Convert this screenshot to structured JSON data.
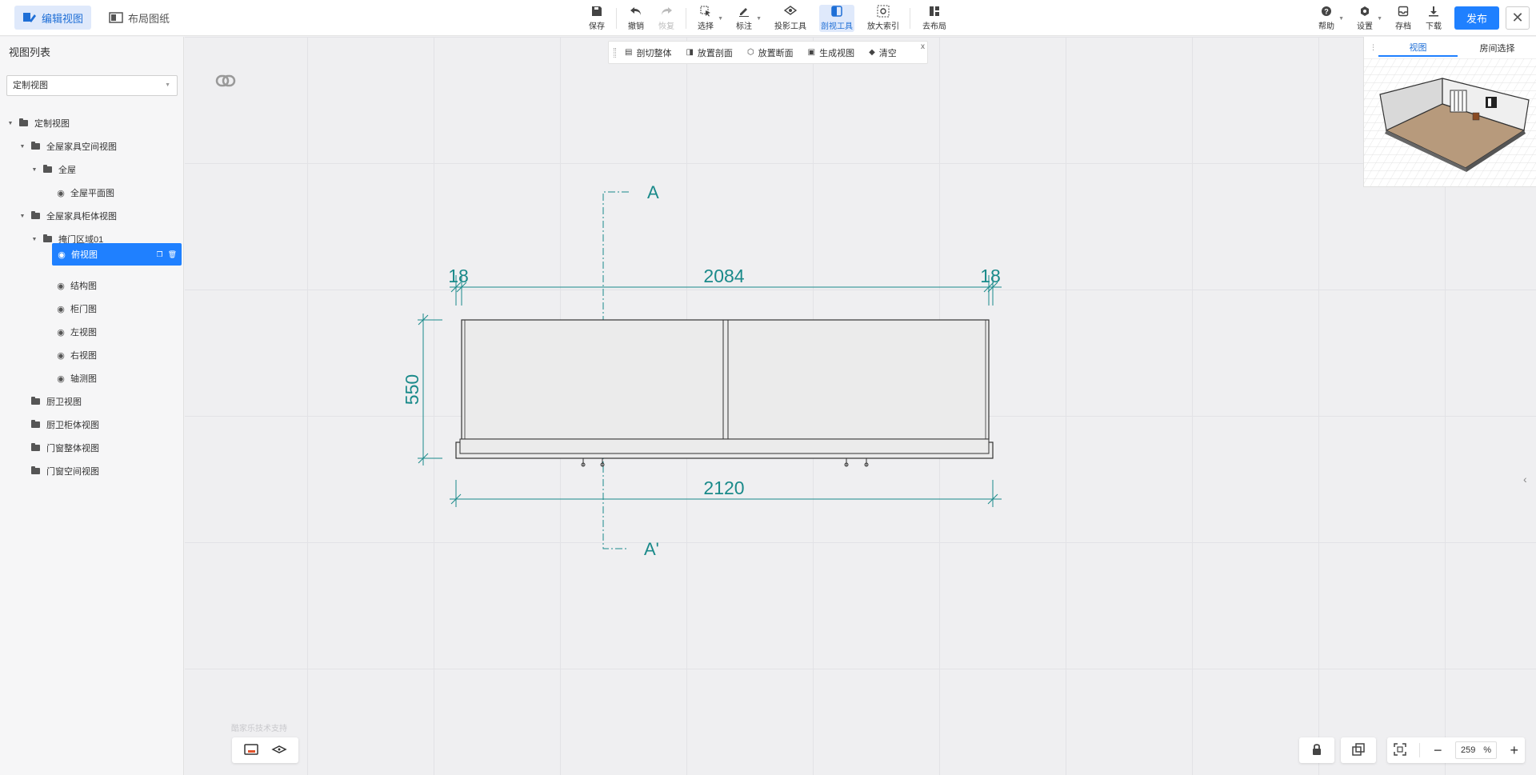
{
  "header": {
    "tabs": [
      {
        "label": "编辑视图",
        "active": true
      },
      {
        "label": "布局图纸",
        "active": false
      }
    ],
    "tools": [
      {
        "label": "保存",
        "icon": "save-icon"
      },
      {
        "label": "撤销",
        "icon": "undo-icon"
      },
      {
        "label": "恢复",
        "icon": "redo-icon",
        "disabled": true
      },
      {
        "label": "选择",
        "icon": "select-icon"
      },
      {
        "label": "标注",
        "icon": "annotate-icon"
      },
      {
        "label": "投影工具",
        "icon": "projection-icon"
      },
      {
        "label": "剖视工具",
        "icon": "section-icon",
        "active": true
      },
      {
        "label": "放大索引",
        "icon": "zoom-index-icon"
      },
      {
        "label": "去布局",
        "icon": "layout-icon"
      }
    ],
    "right_tools": [
      {
        "label": "帮助",
        "icon": "help-icon"
      },
      {
        "label": "设置",
        "icon": "settings-icon"
      },
      {
        "label": "存档",
        "icon": "archive-icon"
      },
      {
        "label": "下载",
        "icon": "download-icon"
      }
    ],
    "publish_label": "发布",
    "close_glyph": "✕"
  },
  "sidebar": {
    "title": "视图列表",
    "select_value": "定制视图",
    "tree": [
      {
        "label": "定制视图",
        "type": "folder",
        "expanded": true
      },
      {
        "label": "全屋家具空间视图",
        "type": "folder",
        "expanded": true
      },
      {
        "label": "全屋",
        "type": "folder",
        "expanded": true
      },
      {
        "label": "全屋平面图",
        "type": "view"
      },
      {
        "label": "全屋家具柜体视图",
        "type": "folder",
        "expanded": true
      },
      {
        "label": "掩门区域01",
        "type": "folder",
        "expanded": true
      },
      {
        "label": "俯视图",
        "type": "view",
        "selected": true
      },
      {
        "label": "结构图",
        "type": "view"
      },
      {
        "label": "柜门图",
        "type": "view"
      },
      {
        "label": "左视图",
        "type": "view"
      },
      {
        "label": "右视图",
        "type": "view"
      },
      {
        "label": "轴测图",
        "type": "view"
      },
      {
        "label": "厨卫视图",
        "type": "folder"
      },
      {
        "label": "厨卫柜体视图",
        "type": "folder"
      },
      {
        "label": "门窗整体视图",
        "type": "folder"
      },
      {
        "label": "门窗空间视图",
        "type": "folder"
      }
    ]
  },
  "section_toolbar": {
    "buttons": [
      {
        "label": "剖切整体",
        "icon": "section-whole-icon"
      },
      {
        "label": "放置剖面",
        "icon": "place-section-icon"
      },
      {
        "label": "放置断面",
        "icon": "place-break-icon"
      },
      {
        "label": "生成视图",
        "icon": "generate-view-icon"
      },
      {
        "label": "清空",
        "icon": "clear-icon"
      }
    ],
    "close_glyph": "x"
  },
  "drawing": {
    "section_label_top": "A",
    "section_label_bottom": "A'",
    "dim_top_left": "18",
    "dim_top_middle": "2084",
    "dim_top_right": "18",
    "dim_left": "550",
    "dim_bottom": "2120",
    "line_color": "#1a8a8a"
  },
  "preview": {
    "tabs": [
      {
        "label": "视图",
        "active": true
      },
      {
        "label": "房间选择",
        "active": false
      }
    ]
  },
  "footer": {
    "watermark": "酷家乐技术支持",
    "zoom_value": "259",
    "zoom_unit": "%"
  },
  "colors": {
    "accent": "#1f80ff",
    "dimension": "#1a8a8a"
  }
}
